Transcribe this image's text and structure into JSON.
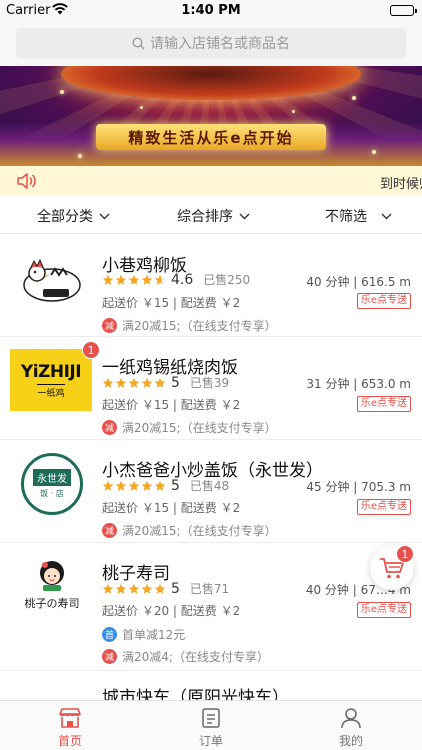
{
  "status_bar": {
    "carrier": "Carrier",
    "time": "1:40 PM"
  },
  "search": {
    "placeholder": "请输入店铺名或商品名"
  },
  "banner": {
    "slogan": "精致生活从乐e点开始"
  },
  "notice": {
    "text": "到时候帅"
  },
  "filters": {
    "category": "全部分类",
    "sort": "综合排序",
    "filter": "不筛选"
  },
  "colors": {
    "accent": "#e8504b",
    "star": "#f5a623",
    "promo_blue": "#3b8fe8",
    "notice_bg": "#fff7d6"
  },
  "shops": [
    {
      "name": "小巷鸡柳饭",
      "rating": "4.6",
      "rating_value": 4.6,
      "sold": "已售250",
      "distance": "40 分钟 | 616.5 m",
      "fee": "起送价 ￥15 | 配送费 ￥2",
      "tag": "乐e点专送",
      "promos": [
        {
          "badge": "减",
          "text": "满20减15;（在线支付专享）",
          "color": "red"
        }
      ]
    },
    {
      "name": "一纸鸡锡纸烧肉饭",
      "rating": "5",
      "rating_value": 5,
      "sold": "已售39",
      "distance": "31 分钟 | 653.0 m",
      "fee": "起送价 ￥15 | 配送费 ￥2",
      "tag": "乐e点专送",
      "cart_count": "1",
      "logo_text": "YiZHIJI",
      "logo_sub": "一纸鸡",
      "promos": [
        {
          "badge": "减",
          "text": "满20减15;（在线支付专享）",
          "color": "red"
        }
      ]
    },
    {
      "name": "小杰爸爸小炒盖饭（永世发）",
      "rating": "5",
      "rating_value": 5,
      "sold": "已售48",
      "distance": "45 分钟 | 705.3 m",
      "fee": "起送价 ￥15 | 配送费 ￥2",
      "tag": "乐e点专送",
      "logo_text": "永世发",
      "logo_sub": "饭 · 店",
      "promos": [
        {
          "badge": "减",
          "text": "满20减15;（在线支付专享）",
          "color": "red"
        }
      ]
    },
    {
      "name": "桃子寿司",
      "rating": "5",
      "rating_value": 5,
      "sold": "已售71",
      "distance": "40 分钟 | 67…4 m",
      "fee": "起送价 ￥20 | 配送费 ￥2",
      "tag": "乐e点专送",
      "logo_text": "桃子の寿司",
      "promos": [
        {
          "badge": "首",
          "text": "首单减12元",
          "color": "blue"
        },
        {
          "badge": "减",
          "text": "满20减4;（在线支付专享）",
          "color": "red"
        }
      ]
    },
    {
      "name": "城市快车（原阳光快车）"
    }
  ],
  "cart": {
    "count": "1"
  },
  "tabbar": {
    "home": "首页",
    "orders": "订单",
    "mine": "我的"
  }
}
